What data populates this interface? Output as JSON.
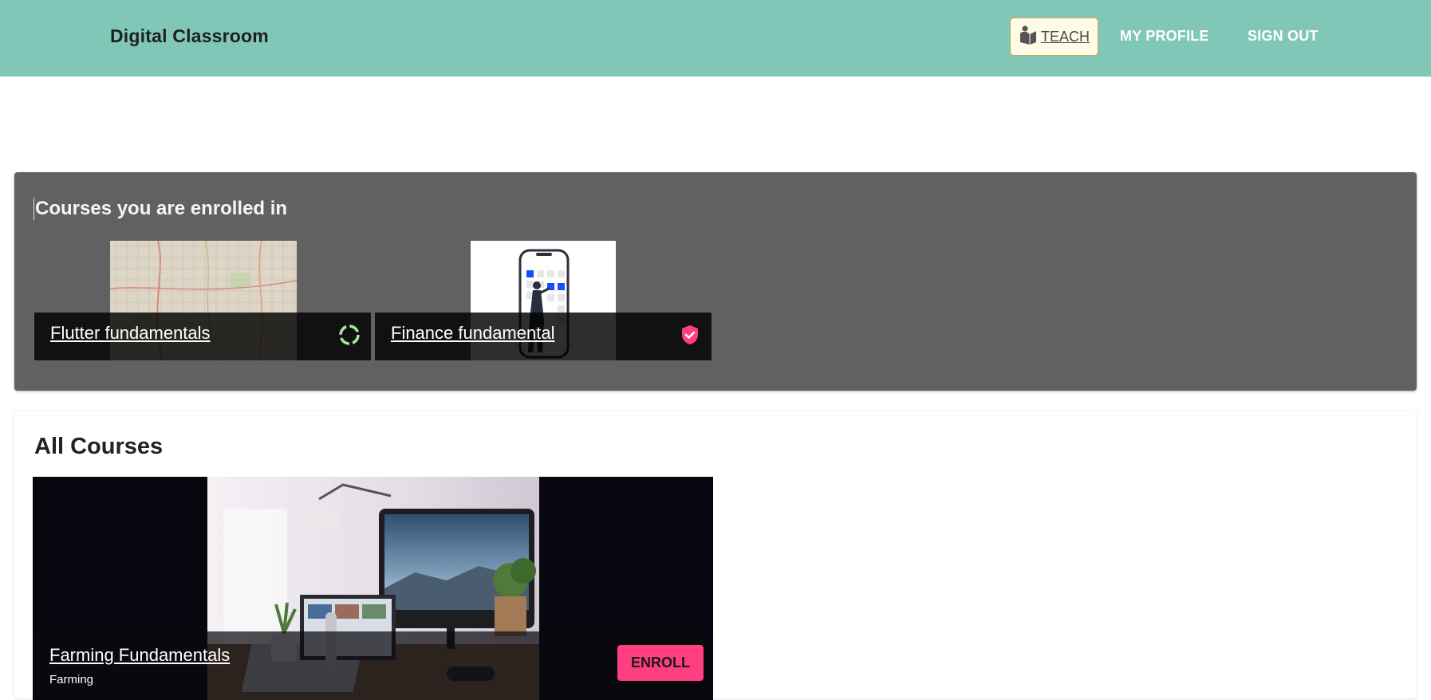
{
  "app": {
    "title": "Digital Classroom"
  },
  "nav": {
    "teach_label": "TEACH",
    "profile_label": "MY PROFILE",
    "signout_label": "SIGN OUT"
  },
  "enrolled": {
    "title": "Courses you are enrolled in",
    "courses": [
      {
        "name": "Flutter fundamentals",
        "status_icon": "in-progress-icon"
      },
      {
        "name": "Finance fundamental",
        "status_icon": "verified-shield-icon"
      }
    ]
  },
  "all_courses": {
    "title": "All Courses",
    "courses": [
      {
        "name": "Farming Fundamentals",
        "category": "Farming",
        "enroll_label": "ENROLL"
      }
    ]
  },
  "colors": {
    "topbar": "#80c7b8",
    "enrolled_panel": "#616161",
    "accent_pink": "#ff3f7f",
    "progress_green": "#a8e6a0"
  }
}
